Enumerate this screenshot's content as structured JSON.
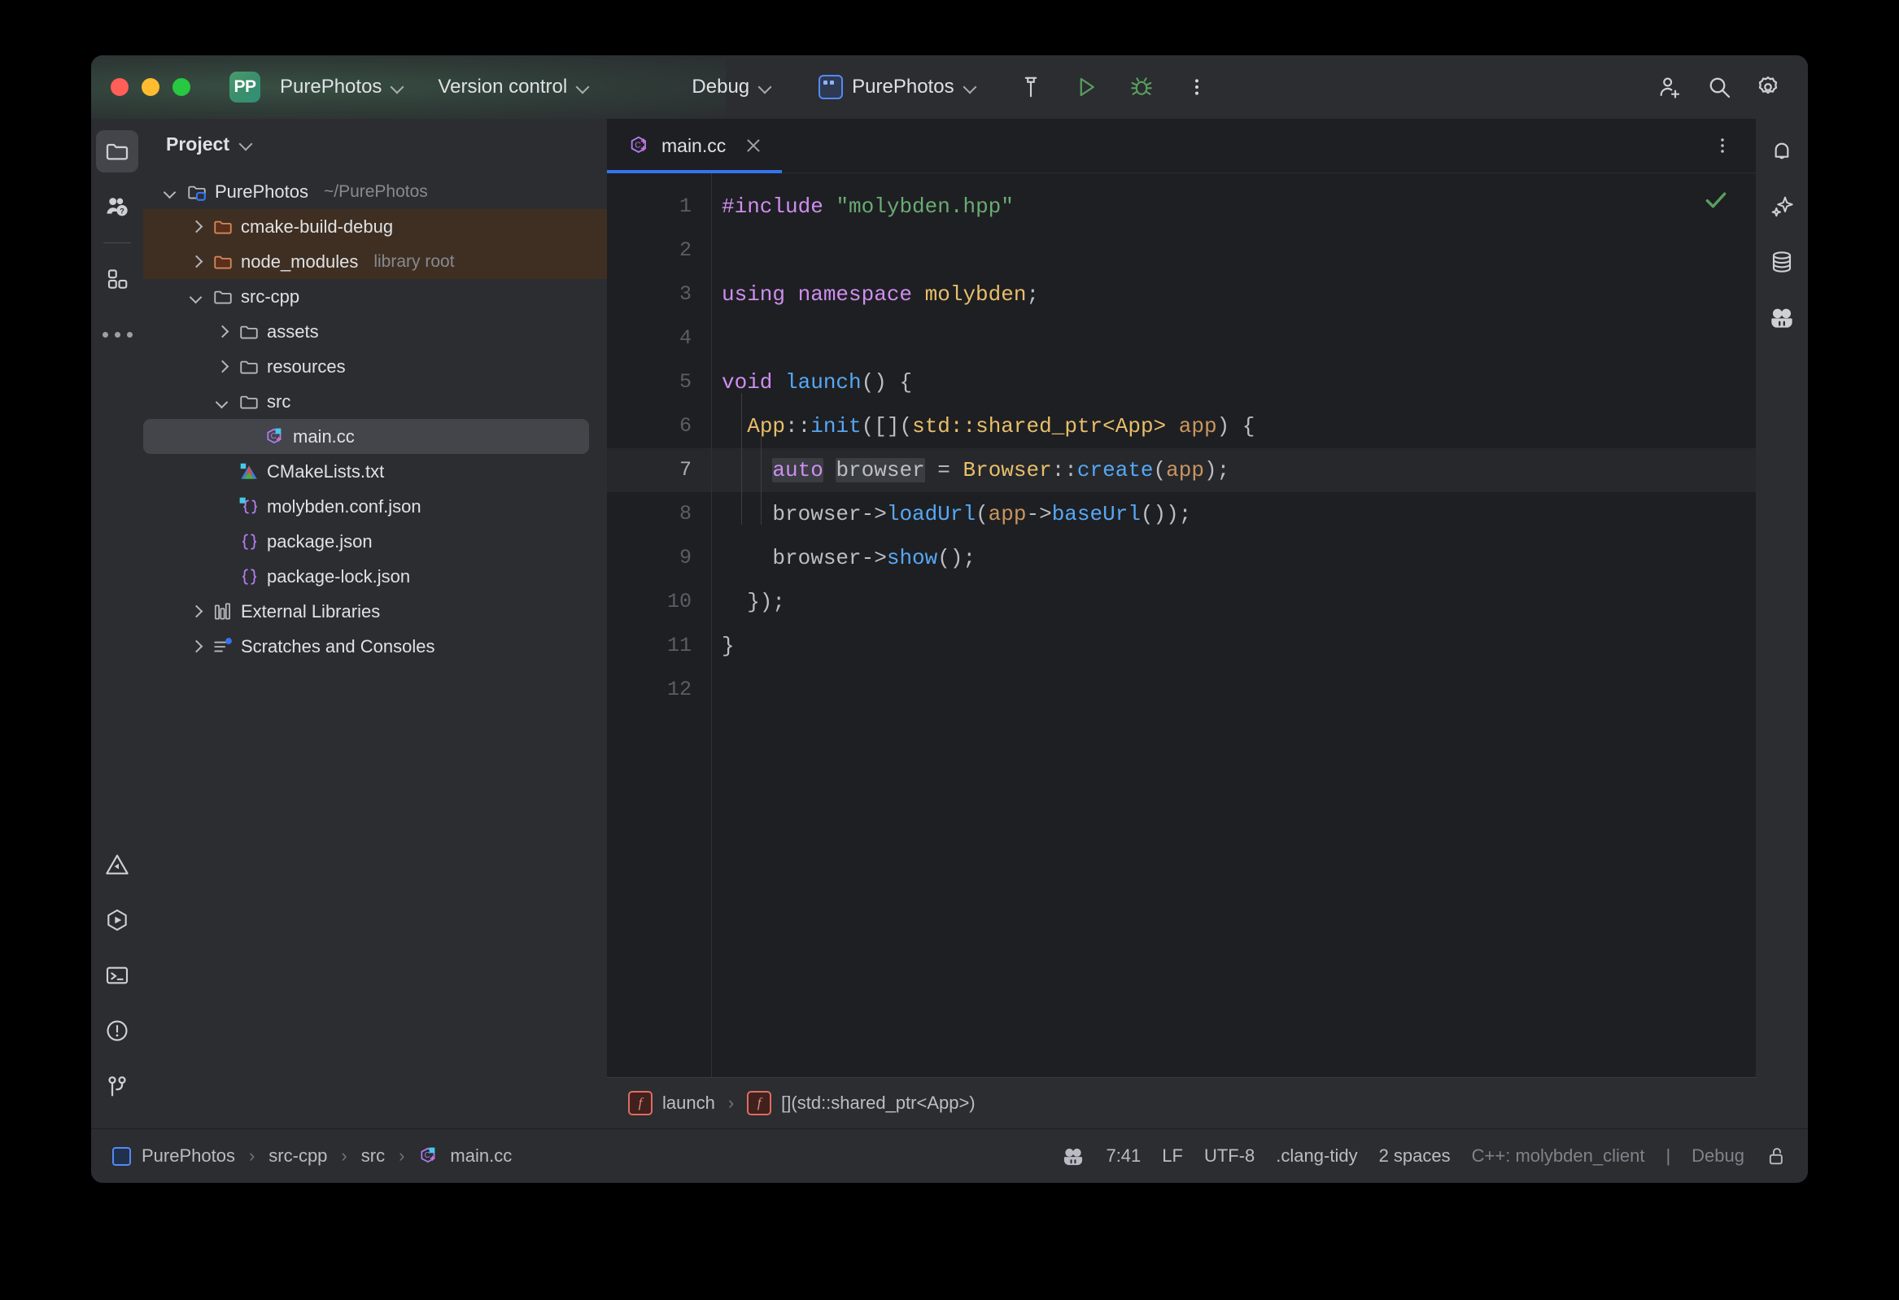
{
  "titlebar": {
    "app_badge": "PP",
    "project_name": "PurePhotos",
    "vcs_label": "Version control",
    "run_mode": "Debug",
    "run_config": "PurePhotos",
    "icons": {
      "build": "hammer-icon",
      "run": "run-icon",
      "debug": "debug-icon",
      "more": "more-vertical-icon",
      "account": "add-account-icon",
      "search": "search-icon",
      "settings": "gear-icon"
    }
  },
  "left_rail": {
    "top": [
      {
        "name": "project-tool-window",
        "icon": "folder-icon",
        "active": true
      },
      {
        "name": "learn-tool-window",
        "icon": "people-question-icon",
        "active": false
      }
    ],
    "after_sep": [
      {
        "name": "plugins-tool-window",
        "icon": "squares-icon",
        "active": false
      },
      {
        "name": "more-tool-windows",
        "icon": "more-horizontal-icon",
        "active": false
      }
    ],
    "bottom": [
      {
        "name": "problems-tool-window",
        "icon": "warning-triangle-icon"
      },
      {
        "name": "run-tool-window",
        "icon": "run-hex-icon"
      },
      {
        "name": "terminal-tool-window",
        "icon": "terminal-icon"
      },
      {
        "name": "alerts-tool-window",
        "icon": "exclamation-circle-icon"
      },
      {
        "name": "version-control-tool-window",
        "icon": "branch-icon"
      }
    ]
  },
  "right_rail": [
    {
      "name": "notifications",
      "icon": "bell-icon"
    },
    {
      "name": "ai-assistant",
      "icon": "sparkle-icon"
    },
    {
      "name": "database",
      "icon": "database-icon"
    },
    {
      "name": "junie",
      "icon": "junie-face-icon"
    }
  ],
  "project_panel": {
    "title": "Project",
    "tree": [
      {
        "depth": 0,
        "arrow": "down",
        "icon": "project-folder-icon",
        "label": "PurePhotos",
        "hint": "~/PurePhotos",
        "state": "normal"
      },
      {
        "depth": 1,
        "arrow": "right",
        "icon": "excluded-folder-icon",
        "label": "cmake-build-debug",
        "hint": "",
        "state": "excluded"
      },
      {
        "depth": 1,
        "arrow": "right",
        "icon": "excluded-folder-icon",
        "label": "node_modules",
        "hint": "library root",
        "state": "excluded"
      },
      {
        "depth": 1,
        "arrow": "down",
        "icon": "folder-icon",
        "label": "src-cpp",
        "hint": "",
        "state": "normal"
      },
      {
        "depth": 2,
        "arrow": "right",
        "icon": "folder-icon",
        "label": "assets",
        "hint": "",
        "state": "normal"
      },
      {
        "depth": 2,
        "arrow": "right",
        "icon": "folder-icon",
        "label": "resources",
        "hint": "",
        "state": "normal"
      },
      {
        "depth": 2,
        "arrow": "down",
        "icon": "folder-icon",
        "label": "src",
        "hint": "",
        "state": "normal"
      },
      {
        "depth": 3,
        "arrow": "none",
        "icon": "cpp-file-icon",
        "label": "main.cc",
        "hint": "",
        "state": "selected"
      },
      {
        "depth": 2,
        "arrow": "none",
        "icon": "cmake-file-icon",
        "label": "CMakeLists.txt",
        "hint": "",
        "state": "normal"
      },
      {
        "depth": 2,
        "arrow": "none",
        "icon": "json-file-icon",
        "label": "molybden.conf.json",
        "hint": "",
        "state": "normal"
      },
      {
        "depth": 2,
        "arrow": "none",
        "icon": "json-plain-icon",
        "label": "package.json",
        "hint": "",
        "state": "normal"
      },
      {
        "depth": 2,
        "arrow": "none",
        "icon": "json-plain-icon",
        "label": "package-lock.json",
        "hint": "",
        "state": "normal"
      },
      {
        "depth": 1,
        "arrow": "right",
        "icon": "library-icon",
        "label": "External Libraries",
        "hint": "",
        "state": "normal"
      },
      {
        "depth": 1,
        "arrow": "right",
        "icon": "scratches-icon",
        "label": "Scratches and Consoles",
        "hint": "",
        "state": "normal"
      }
    ]
  },
  "editor": {
    "tabs": [
      {
        "label": "main.cc",
        "icon": "cpp-file-icon",
        "active": true
      }
    ],
    "inspection_status": "ok-check",
    "line_numbers": [
      "1",
      "2",
      "3",
      "4",
      "5",
      "6",
      "7",
      "8",
      "9",
      "10",
      "11",
      "12"
    ],
    "current_line": 7,
    "code_lines": [
      {
        "n": 1,
        "tokens": [
          {
            "t": "#include ",
            "c": "kw"
          },
          {
            "t": "\"molybden.hpp\"",
            "c": "str"
          }
        ]
      },
      {
        "n": 2,
        "tokens": []
      },
      {
        "n": 3,
        "tokens": [
          {
            "t": "using namespace ",
            "c": "kw"
          },
          {
            "t": "molybden",
            "c": "type"
          },
          {
            "t": ";",
            "c": "plain"
          }
        ]
      },
      {
        "n": 4,
        "tokens": []
      },
      {
        "n": 5,
        "tokens": [
          {
            "t": "void ",
            "c": "kw"
          },
          {
            "t": "launch",
            "c": "fn"
          },
          {
            "t": "() {",
            "c": "plain"
          }
        ]
      },
      {
        "n": 6,
        "tokens": [
          {
            "t": "  ",
            "c": "plain"
          },
          {
            "t": "App",
            "c": "type"
          },
          {
            "t": "::",
            "c": "plain"
          },
          {
            "t": "init",
            "c": "fn"
          },
          {
            "t": "([](",
            "c": "plain"
          },
          {
            "t": "std::shared_ptr<App>",
            "c": "type"
          },
          {
            "t": " ",
            "c": "plain"
          },
          {
            "t": "app",
            "c": "param"
          },
          {
            "t": ") {",
            "c": "plain"
          }
        ]
      },
      {
        "n": 7,
        "tokens": [
          {
            "t": "    ",
            "c": "plain"
          },
          {
            "t": "auto",
            "c": "kw"
          },
          {
            "t": " ",
            "c": "plain"
          },
          {
            "t": "browser",
            "c": "plain"
          },
          {
            "t": " = ",
            "c": "plain"
          },
          {
            "t": "Browser",
            "c": "type"
          },
          {
            "t": "::",
            "c": "plain"
          },
          {
            "t": "create",
            "c": "fn"
          },
          {
            "t": "(",
            "c": "plain"
          },
          {
            "t": "app",
            "c": "param"
          },
          {
            "t": ");",
            "c": "plain"
          }
        ]
      },
      {
        "n": 8,
        "tokens": [
          {
            "t": "    browser->",
            "c": "plain"
          },
          {
            "t": "loadUrl",
            "c": "fn"
          },
          {
            "t": "(",
            "c": "plain"
          },
          {
            "t": "app",
            "c": "param"
          },
          {
            "t": "->",
            "c": "plain"
          },
          {
            "t": "baseUrl",
            "c": "fn"
          },
          {
            "t": "());",
            "c": "plain"
          }
        ]
      },
      {
        "n": 9,
        "tokens": [
          {
            "t": "    browser->",
            "c": "plain"
          },
          {
            "t": "show",
            "c": "fn"
          },
          {
            "t": "();",
            "c": "plain"
          }
        ]
      },
      {
        "n": 10,
        "tokens": [
          {
            "t": "  });",
            "c": "plain"
          }
        ]
      },
      {
        "n": 11,
        "tokens": [
          {
            "t": "}",
            "c": "plain"
          }
        ]
      },
      {
        "n": 12,
        "tokens": []
      }
    ],
    "breadcrumbs": [
      {
        "icon": "function-icon",
        "label": "launch"
      },
      {
        "icon": "function-icon",
        "label": "[](std::shared_ptr<App>)"
      }
    ]
  },
  "statusbar": {
    "path": [
      "PurePhotos",
      "src-cpp",
      "src",
      "main.cc"
    ],
    "caret_position": "7:41",
    "line_separator": "LF",
    "encoding": "UTF-8",
    "inspection_profile": ".clang-tidy",
    "indent": "2 spaces",
    "toolchain": "C++: molybden_client",
    "build_type": "Debug",
    "lock_state": "unlocked-icon",
    "junie_icon": "junie-face-icon"
  },
  "colors": {
    "accent_blue": "#3574f0",
    "window_bg": "#2b2d30",
    "editor_bg": "#1e1f22",
    "excluded_row": "#3f2f22",
    "selection": "#43454a",
    "keyword": "#cf8ef0",
    "string": "#6aab73",
    "type": "#e8bf6a",
    "function": "#56a8f5",
    "parameter": "#c9955f",
    "ok_green": "#5a9e5f"
  }
}
